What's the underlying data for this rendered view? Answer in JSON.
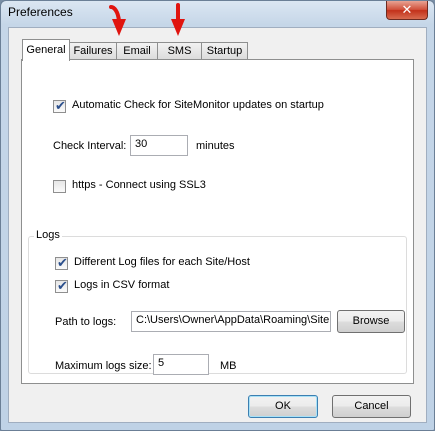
{
  "window": {
    "title": "Preferences",
    "close_glyph": "✕"
  },
  "tabs": [
    {
      "label": "General",
      "active": true
    },
    {
      "label": "Failures",
      "active": false
    },
    {
      "label": "Email",
      "active": false
    },
    {
      "label": "SMS",
      "active": false
    },
    {
      "label": "Startup",
      "active": false
    }
  ],
  "general": {
    "auto_check": {
      "label": "Automatic Check for SiteMonitor updates on startup",
      "checked": true
    },
    "interval": {
      "label": "Check Interval:",
      "value": "30",
      "unit": "minutes"
    },
    "https": {
      "label": "https - Connect using SSL3",
      "checked": false
    },
    "logs": {
      "group_title": "Logs",
      "different_files": {
        "label": "Different Log files for each Site/Host",
        "checked": true
      },
      "csv_format": {
        "label": "Logs in CSV format",
        "checked": true
      },
      "path": {
        "label": "Path to logs:",
        "value": "C:\\Users\\Owner\\AppData\\Roaming\\Site"
      },
      "browse_label": "Browse",
      "max_size": {
        "label": "Maximum logs size:",
        "value": "5",
        "unit": "MB"
      }
    }
  },
  "footer": {
    "ok_label": "OK",
    "cancel_label": "Cancel"
  },
  "colors": {
    "annotation_arrow": "#e0140f",
    "check_tick": "#2b4f8c"
  },
  "icons": {
    "tick": "✔"
  }
}
